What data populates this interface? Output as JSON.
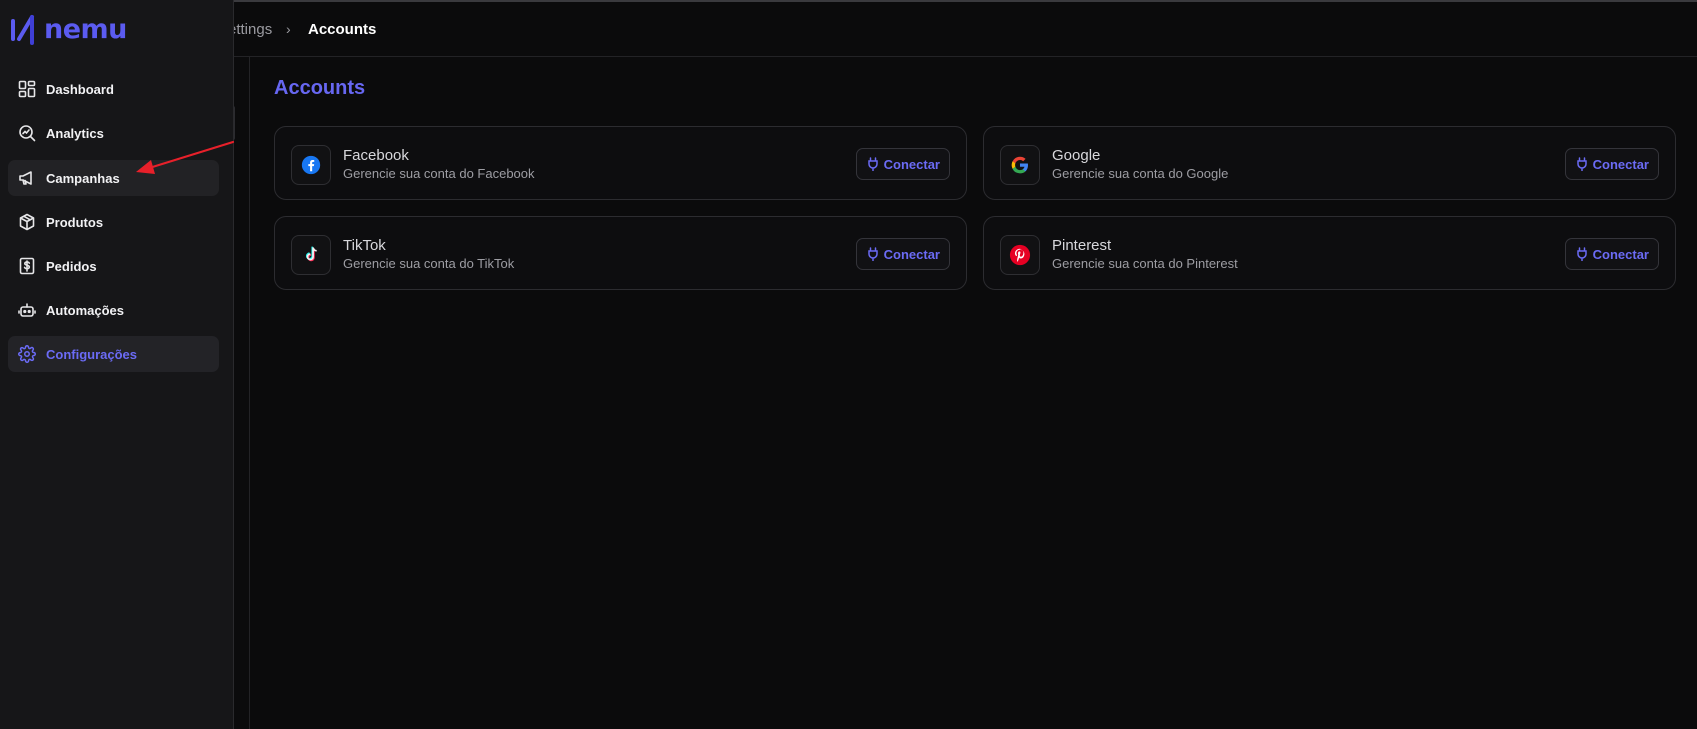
{
  "app": {
    "logo_text": "nemu"
  },
  "breadcrumb": {
    "previous": "ettings",
    "separator": "›",
    "current": "Accounts"
  },
  "sidebar": {
    "items": [
      {
        "label": "Dashboard",
        "icon": "grid-icon"
      },
      {
        "label": "Analytics",
        "icon": "analytics-search-icon"
      },
      {
        "label": "Campanhas",
        "icon": "megaphone-icon"
      },
      {
        "label": "Produtos",
        "icon": "package-icon"
      },
      {
        "label": "Pedidos",
        "icon": "dollar-receipt-icon"
      },
      {
        "label": "Automações",
        "icon": "bot-icon"
      },
      {
        "label": "Configurações",
        "icon": "gear-icon"
      }
    ],
    "hovered_index": 2,
    "active_index": 6
  },
  "main": {
    "title": "Accounts",
    "accounts": [
      {
        "name": "Facebook",
        "description": "Gerencie sua conta do Facebook",
        "button": "Conectar",
        "icon": "facebook-icon"
      },
      {
        "name": "Google",
        "description": "Gerencie sua conta do Google",
        "button": "Conectar",
        "icon": "google-icon"
      },
      {
        "name": "TikTok",
        "description": "Gerencie sua conta do TikTok",
        "button": "Conectar",
        "icon": "tiktok-icon"
      },
      {
        "name": "Pinterest",
        "description": "Gerencie sua conta do Pinterest",
        "button": "Conectar",
        "icon": "pinterest-icon"
      }
    ]
  },
  "colors": {
    "accent": "#6b6bf5",
    "annotation_arrow": "#e8202a",
    "background": "#0b0b0c",
    "sidebar": "#161618"
  }
}
